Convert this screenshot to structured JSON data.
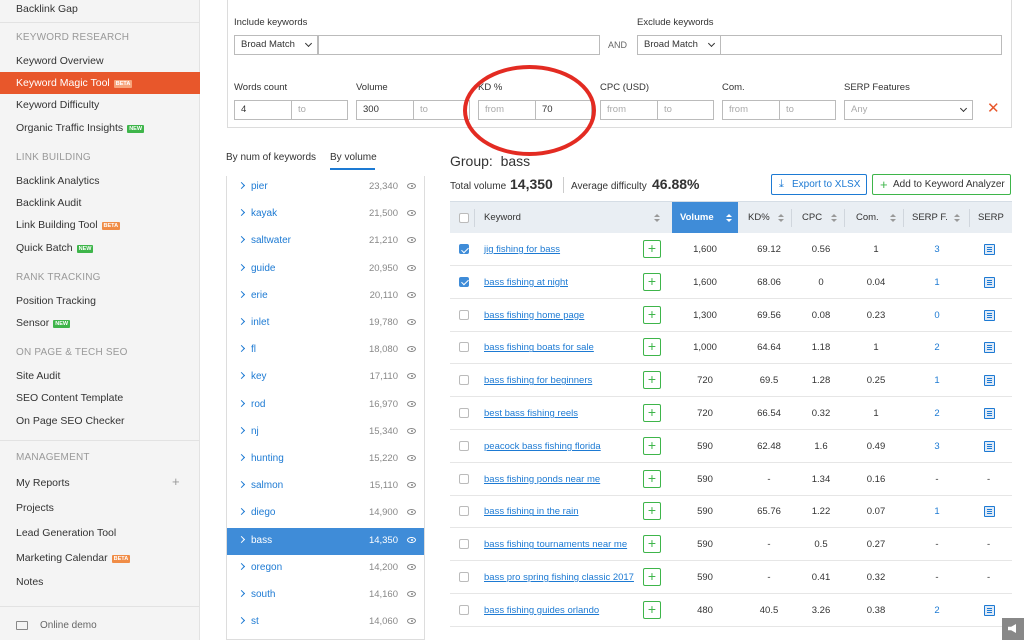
{
  "sidebar": {
    "top_item": "Backlink Gap",
    "sections": [
      {
        "heading": "KEYWORD RESEARCH",
        "items": [
          {
            "label": "Keyword Overview"
          },
          {
            "label": "Keyword Magic Tool",
            "badge": "BETA",
            "active": true
          },
          {
            "label": "Keyword Difficulty"
          },
          {
            "label": "Organic Traffic Insights",
            "badge": "NEW"
          }
        ]
      },
      {
        "heading": "LINK BUILDING",
        "items": [
          {
            "label": "Backlink Analytics"
          },
          {
            "label": "Backlink Audit"
          },
          {
            "label": "Link Building Tool",
            "badge": "BETA"
          },
          {
            "label": "Quick Batch",
            "badge": "NEW"
          }
        ]
      },
      {
        "heading": "RANK TRACKING",
        "items": [
          {
            "label": "Position Tracking"
          },
          {
            "label": "Sensor",
            "badge": "NEW"
          }
        ]
      },
      {
        "heading": "ON PAGE & TECH SEO",
        "items": [
          {
            "label": "Site Audit"
          },
          {
            "label": "SEO Content Template"
          },
          {
            "label": "On Page SEO Checker"
          }
        ]
      },
      {
        "heading": "MANAGEMENT",
        "items": [
          {
            "label": "My Reports",
            "plus": "+"
          },
          {
            "label": "Projects"
          },
          {
            "label": "Lead Generation Tool"
          },
          {
            "label": "Marketing Calendar",
            "badge": "BETA"
          },
          {
            "label": "Notes"
          }
        ]
      }
    ],
    "online_demo": "Online demo"
  },
  "filters": {
    "include_label": "Include keywords",
    "include_match": "Broad Match",
    "and_text": "AND",
    "exclude_label": "Exclude keywords",
    "exclude_match": "Broad Match",
    "words_count": {
      "label": "Words count",
      "from": "4",
      "to": "to"
    },
    "volume": {
      "label": "Volume",
      "from": "300",
      "to": "to"
    },
    "kd": {
      "label": "KD %",
      "from": "from",
      "to": "70"
    },
    "cpc": {
      "label": "CPC (USD)",
      "from": "from",
      "to": "to"
    },
    "com": {
      "label": "Com.",
      "from": "from",
      "to": "to"
    },
    "serp": {
      "label": "SERP Features",
      "value": "Any"
    },
    "close": "✕"
  },
  "tabs": {
    "by_num": "By num of keywords",
    "by_volume": "By volume"
  },
  "groups": [
    {
      "name": "pier",
      "volume": "23,340"
    },
    {
      "name": "kayak",
      "volume": "21,500"
    },
    {
      "name": "saltwater",
      "volume": "21,210"
    },
    {
      "name": "guide",
      "volume": "20,950"
    },
    {
      "name": "erie",
      "volume": "20,110"
    },
    {
      "name": "inlet",
      "volume": "19,780"
    },
    {
      "name": "fl",
      "volume": "18,080"
    },
    {
      "name": "key",
      "volume": "17,110"
    },
    {
      "name": "rod",
      "volume": "16,970"
    },
    {
      "name": "nj",
      "volume": "15,340"
    },
    {
      "name": "hunting",
      "volume": "15,220"
    },
    {
      "name": "salmon",
      "volume": "15,110"
    },
    {
      "name": "diego",
      "volume": "14,900"
    },
    {
      "name": "bass",
      "volume": "14,350",
      "selected": true
    },
    {
      "name": "oregon",
      "volume": "14,200"
    },
    {
      "name": "south",
      "volume": "14,160"
    },
    {
      "name": "st",
      "volume": "14,060"
    }
  ],
  "group": {
    "title_prefix": "Group:",
    "title": "bass",
    "total_volume_label": "Total volume",
    "total_volume": "14,350",
    "avg_difficulty_label": "Average difficulty",
    "avg_difficulty": "46.88%",
    "export_label": "Export to XLSX",
    "analyzer_label": "Add to Keyword Analyzer"
  },
  "table": {
    "headers": {
      "keyword": "Keyword",
      "volume": "Volume",
      "kd": "KD%",
      "cpc": "CPC",
      "com": "Com.",
      "serpf": "SERP F.",
      "serp": "SERP"
    },
    "rows": [
      {
        "checked": true,
        "keyword": "jig fishing for bass",
        "volume": "1,600",
        "kd": "69.12",
        "cpc": "0.56",
        "com": "1",
        "serpf": "3",
        "serp_icon": true
      },
      {
        "checked": true,
        "keyword": "bass fishing at night",
        "volume": "1,600",
        "kd": "68.06",
        "cpc": "0",
        "com": "0.04",
        "serpf": "1",
        "serp_icon": true
      },
      {
        "checked": false,
        "keyword": "bass fishing home page",
        "volume": "1,300",
        "kd": "69.56",
        "cpc": "0.08",
        "com": "0.23",
        "serpf": "0",
        "serp_icon": true
      },
      {
        "checked": false,
        "keyword": "bass fishing boats for sale",
        "volume": "1,000",
        "kd": "64.64",
        "cpc": "1.18",
        "com": "1",
        "serpf": "2",
        "serp_icon": true
      },
      {
        "checked": false,
        "keyword": "bass fishing for beginners",
        "volume": "720",
        "kd": "69.5",
        "cpc": "1.28",
        "com": "0.25",
        "serpf": "1",
        "serp_icon": true
      },
      {
        "checked": false,
        "keyword": "best bass fishing reels",
        "volume": "720",
        "kd": "66.54",
        "cpc": "0.32",
        "com": "1",
        "serpf": "2",
        "serp_icon": true
      },
      {
        "checked": false,
        "keyword": "peacock bass fishing florida",
        "volume": "590",
        "kd": "62.48",
        "cpc": "1.6",
        "com": "0.49",
        "serpf": "3",
        "serp_icon": true
      },
      {
        "checked": false,
        "keyword": "bass fishing ponds near me",
        "volume": "590",
        "kd": "-",
        "cpc": "1.34",
        "com": "0.16",
        "serpf": "-",
        "serp_text": "-"
      },
      {
        "checked": false,
        "keyword": "bass fishing in the rain",
        "volume": "590",
        "kd": "65.76",
        "cpc": "1.22",
        "com": "0.07",
        "serpf": "1",
        "serp_icon": true
      },
      {
        "checked": false,
        "keyword": "bass fishing tournaments near me",
        "volume": "590",
        "kd": "-",
        "cpc": "0.5",
        "com": "0.27",
        "serpf": "-",
        "serp_text": "-"
      },
      {
        "checked": false,
        "keyword": "bass pro spring fishing classic 2017",
        "volume": "590",
        "kd": "-",
        "cpc": "0.41",
        "com": "0.32",
        "serpf": "-",
        "serp_text": "-"
      },
      {
        "checked": false,
        "keyword": "bass fishing guides orlando",
        "volume": "480",
        "kd": "40.5",
        "cpc": "3.26",
        "com": "0.38",
        "serpf": "2",
        "serp_icon": true
      }
    ]
  },
  "colors": {
    "accent": "#e8572b",
    "link": "#1d7ad3",
    "selected": "#3f8cd8",
    "green": "#3eb54a",
    "highlight_oval": "#e32b22"
  }
}
